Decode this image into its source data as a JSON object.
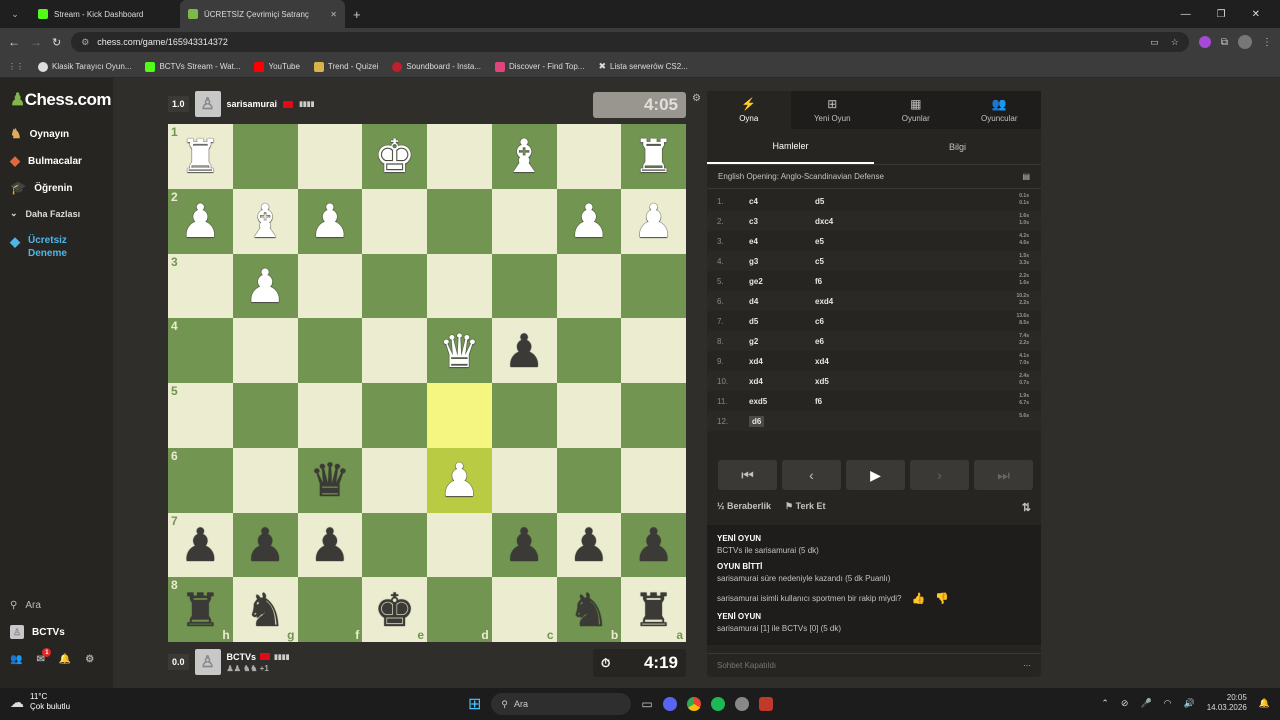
{
  "browser": {
    "tabs": [
      {
        "label": "Stream - Kick Dashboard"
      },
      {
        "label": "ÜCRETSİZ Çevrimiçi Satranç"
      }
    ],
    "url": "chess.com/game/165943314372",
    "bookmarks": [
      "Klasik Tarayıcı Oyun...",
      "BCTVs Stream - Wat...",
      "YouTube",
      "Trend - Quizei",
      "Soundboard - Insta...",
      "Discover - Find Top...",
      "Lista serwerów CS2..."
    ]
  },
  "sidebar": {
    "logo": "Chess.com",
    "items": [
      {
        "label": "Oynayın"
      },
      {
        "label": "Bulmacalar"
      },
      {
        "label": "Öğrenin"
      },
      {
        "label": "Daha Fazlası"
      },
      {
        "label": "Ücretsiz Deneme"
      }
    ],
    "search": "Ara",
    "user": "BCTVs",
    "mail_badge": "1"
  },
  "top_player": {
    "rating_box": "1.0",
    "name": "sarisamurai",
    "clock": "4:05"
  },
  "bottom_player": {
    "rating_box": "0.0",
    "name": "BCTVs",
    "extra": "+1",
    "clock": "4:19"
  },
  "board": {
    "ranks": [
      "1",
      "2",
      "3",
      "4",
      "5",
      "6",
      "7",
      "8"
    ],
    "files": [
      "h",
      "g",
      "f",
      "e",
      "d",
      "c",
      "b",
      "a"
    ]
  },
  "panel": {
    "tabs": [
      {
        "label": "Oyna"
      },
      {
        "label": "Yeni Oyun"
      },
      {
        "label": "Oyunlar"
      },
      {
        "label": "Oyuncular"
      }
    ],
    "subtabs": [
      {
        "label": "Hamleler"
      },
      {
        "label": "Bilgi"
      }
    ],
    "opening": "English Opening: Anglo-Scandinavian Defense",
    "moves": [
      {
        "n": "1.",
        "w": "c4",
        "b": "d5",
        "tw": "0.1s",
        "tb": "0.1s"
      },
      {
        "n": "2.",
        "w": "c3",
        "b": "dxc4",
        "tw": "1.6s",
        "tb": "1.0s"
      },
      {
        "n": "3.",
        "w": "e4",
        "b": "e5",
        "tw": "4.2s",
        "tb": "4.6s"
      },
      {
        "n": "4.",
        "w": "g3",
        "b": "c5",
        "tw": "1.5s",
        "tb": "3.3s"
      },
      {
        "n": "5.",
        "w": "ge2",
        "b": "f6",
        "tw": "2.2s",
        "tb": "1.6s"
      },
      {
        "n": "6.",
        "w": "d4",
        "b": "exd4",
        "tw": "10.2s",
        "tb": "2.2s"
      },
      {
        "n": "7.",
        "w": "d5",
        "b": "c6",
        "tw": "13.6s",
        "tb": "8.5s"
      },
      {
        "n": "8.",
        "w": "g2",
        "b": "e6",
        "tw": "7.4s",
        "tb": "2.2s"
      },
      {
        "n": "9.",
        "w": "xd4",
        "b": "xd4",
        "tw": "4.1s",
        "tb": "7.0s"
      },
      {
        "n": "10.",
        "w": "xd4",
        "b": "xd5",
        "tw": "2.4s",
        "tb": "0.7s"
      },
      {
        "n": "11.",
        "w": "exd5",
        "b": "f6",
        "tw": "1.9s",
        "tb": "6.7s"
      },
      {
        "n": "12.",
        "w": "d6",
        "b": "",
        "tw": "5.6s",
        "tb": ""
      }
    ],
    "draw": "Beraberlik",
    "resign": "Terk Et",
    "chat": {
      "l1": "YENİ OYUN",
      "l2": "BCTVs ile sarisamurai (5 dk)",
      "l3": "OYUN BİTTİ",
      "l4": "sarisamurai süre nedeniyle kazandı (5 dk Puanlı)",
      "l5": "sarisamurai isimli kullanıcı sportmen bir rakip miydi?",
      "l6": "YENİ OYUN",
      "l7": "sarisamurai [1] ile BCTVs [0] (5 dk)"
    },
    "chat_closed": "Sohbet Kapatıldı"
  },
  "taskbar": {
    "weather_temp": "11°C",
    "weather_text": "Çok bulutlu",
    "search": "Ara",
    "time": "20:05",
    "date": "14.03.2026"
  }
}
